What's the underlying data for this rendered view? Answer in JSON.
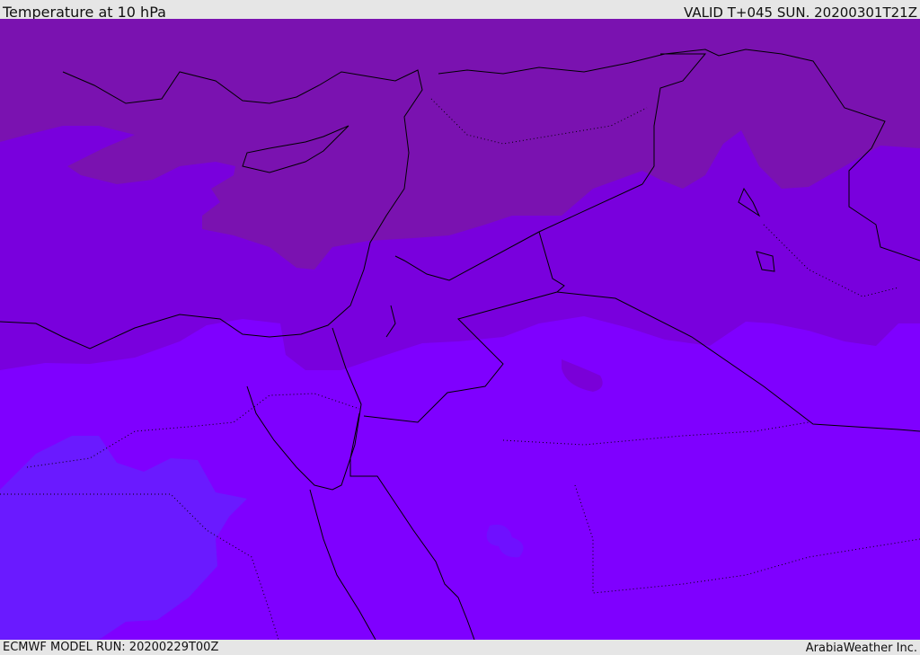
{
  "header": {
    "title": "Temperature at 10 hPa",
    "valid": "VALID T+045 SUN. 20200301T21Z"
  },
  "footer": {
    "model_run": "ECMWF MODEL RUN: 20200229T00Z",
    "credit": "ArabiaWeather Inc."
  },
  "colors": {
    "band_top": "#7a12b0",
    "band_mid": "#7900dd",
    "band_main": "#7f00ff",
    "band_cold": "#6a1aff",
    "coast": "#000000"
  }
}
